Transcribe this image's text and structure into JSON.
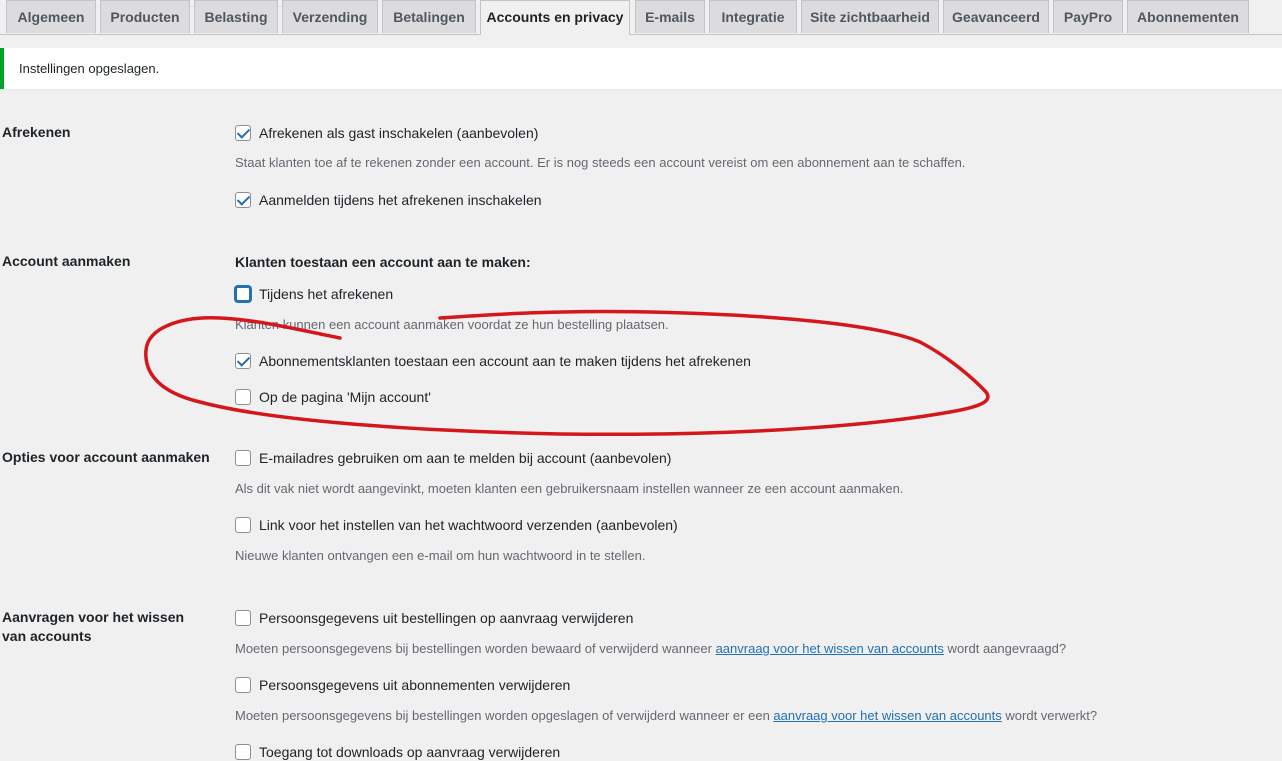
{
  "tabs": [
    {
      "label": "Algemeen",
      "active": false
    },
    {
      "label": "Producten",
      "active": false
    },
    {
      "label": "Belasting",
      "active": false
    },
    {
      "label": "Verzending",
      "active": false
    },
    {
      "label": "Betalingen",
      "active": false
    },
    {
      "label": "Accounts en privacy",
      "active": true
    },
    {
      "label": "E-mails",
      "active": false
    },
    {
      "label": "Integratie",
      "active": false
    },
    {
      "label": "Site zichtbaarheid",
      "active": false
    },
    {
      "label": "Geavanceerd",
      "active": false
    },
    {
      "label": "PayPro",
      "active": false
    },
    {
      "label": "Abonnementen",
      "active": false
    }
  ],
  "notice": {
    "text": "Instellingen opgeslagen.",
    "color": "#00a32a"
  },
  "checkout": {
    "label": "Afrekenen",
    "guest": {
      "label": "Afrekenen als gast inschakelen (aanbevolen)",
      "checked": true
    },
    "guest_desc": "Staat klanten toe af te rekenen zonder een account. Er is nog steeds een account vereist om een abonnement aan te schaffen.",
    "login": {
      "label": "Aanmelden tijdens het afrekenen inschakelen",
      "checked": true
    }
  },
  "account_creation": {
    "label": "Account aanmaken",
    "heading": "Klanten toestaan een account aan te maken:",
    "during_checkout": {
      "label": "Tijdens het afrekenen",
      "checked": false
    },
    "during_checkout_desc": "Klanten kunnen een account aanmaken voordat ze hun bestelling plaatsen.",
    "subscription": {
      "label": "Abonnementsklanten toestaan een account aan te maken tijdens het afrekenen",
      "checked": true
    },
    "my_account": {
      "label": "Op de pagina 'Mijn account'",
      "checked": false
    }
  },
  "account_options": {
    "label": "Opties voor account aanmaken",
    "email_username": {
      "label": "E-mailadres gebruiken om aan te melden bij account (aanbevolen)",
      "checked": false
    },
    "email_username_desc": "Als dit vak niet wordt aangevinkt, moeten klanten een gebruikersnaam instellen wanneer ze een account aanmaken.",
    "password_link": {
      "label": "Link voor het instellen van het wachtwoord verzenden (aanbevolen)",
      "checked": false
    },
    "password_link_desc": "Nieuwe klanten ontvangen een e-mail om hun wachtwoord in te stellen."
  },
  "erasure": {
    "label": "Aanvragen voor het wissen van accounts",
    "orders": {
      "label": "Persoonsgegevens uit bestellingen op aanvraag verwijderen",
      "checked": false
    },
    "orders_desc_pre": "Moeten persoonsgegevens bij bestellingen worden bewaard of verwijderd wanneer ",
    "orders_desc_link": "aanvraag voor het wissen van accounts",
    "orders_desc_post": " wordt aangevraagd?",
    "subscriptions": {
      "label": "Persoonsgegevens uit abonnementen verwijderen",
      "checked": false
    },
    "subscriptions_desc_pre": "Moeten persoonsgegevens bij bestellingen worden opgeslagen of verwijderd wanneer er een ",
    "subscriptions_desc_link": "aanvraag voor het wissen van accounts",
    "subscriptions_desc_post": " wordt verwerkt?",
    "downloads": {
      "label": "Toegang tot downloads op aanvraag verwijderen",
      "checked": false
    }
  },
  "annotation_color": "#d3171b"
}
